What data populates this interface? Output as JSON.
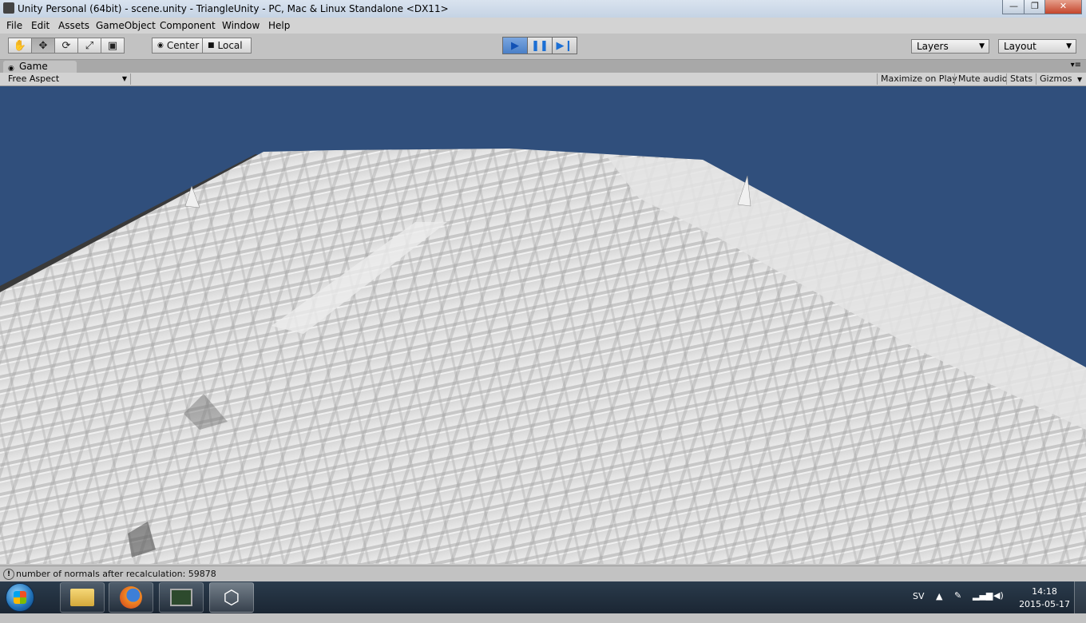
{
  "window": {
    "title": "Unity Personal (64bit) - scene.unity - TriangleUnity - PC, Mac & Linux Standalone <DX11>",
    "minimize": "—",
    "maximize": "❐",
    "close": "✕"
  },
  "menu": [
    "File",
    "Edit",
    "Assets",
    "GameObject",
    "Component",
    "Window",
    "Help"
  ],
  "toolbar": {
    "pivot": "Center",
    "space": "Local",
    "layers": "Layers",
    "layout": "Layout"
  },
  "game_panel": {
    "tab": "Game",
    "aspect": "Free Aspect",
    "maximize_on_play": "Maximize on Play",
    "mute_audio": "Mute audio",
    "stats": "Stats",
    "gizmos": "Gizmos"
  },
  "status": {
    "message": "number of normals after recalculation: 59878"
  },
  "taskbar": {
    "language": "SV",
    "time": "14:18",
    "date": "2015-05-17"
  },
  "colors": {
    "sky": "#304f7c",
    "terrain": "#e6e6e6",
    "play_active": "#4a7fc7"
  },
  "icons": [
    "hand-icon",
    "move-icon",
    "rotate-icon",
    "scale-icon",
    "rect-icon",
    "play-icon",
    "pause-icon",
    "step-icon",
    "windows-start-icon",
    "explorer-icon",
    "firefox-icon",
    "terminal-icon",
    "unity-icon"
  ]
}
